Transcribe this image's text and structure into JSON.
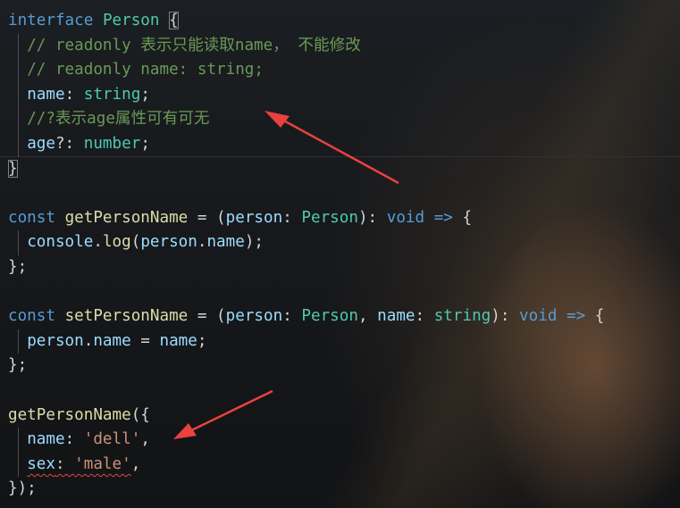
{
  "editor": {
    "line1": {
      "kw": "interface",
      "name": "Person",
      "brace": "{"
    },
    "line2": {
      "comment": "// readonly 表示只能读取name， 不能修改"
    },
    "line3": {
      "comment": "// readonly name: string;"
    },
    "line4": {
      "prop": "name",
      "colon": ": ",
      "type": "string",
      "semi": ";"
    },
    "line5": {
      "comment": "//?表示age属性可有可无"
    },
    "line6": {
      "prop": "age",
      "op": "?: ",
      "type": "number",
      "semi": ";"
    },
    "line7": {
      "brace": "}"
    },
    "line9": {
      "kw": "const",
      "fn": "getPersonName",
      "eq": " = (",
      "param": "person",
      "colon": ": ",
      "type": "Person",
      "close": "): ",
      "ret": "void",
      "arrow": " => ",
      "brace": "{"
    },
    "line10": {
      "obj": "console",
      "dot": ".",
      "fn": "log",
      "open": "(",
      "param": "person",
      "dot2": ".",
      "prop": "name",
      "close": ");"
    },
    "line11": {
      "text": "};"
    },
    "line13": {
      "kw": "const",
      "fn": "setPersonName",
      "eq": " = (",
      "param": "person",
      "colon": ": ",
      "type": "Person",
      "comma": ", ",
      "param2": "name",
      "colon2": ": ",
      "type2": "string",
      "close": "): ",
      "ret": "void",
      "arrow": " => ",
      "brace": "{"
    },
    "line14": {
      "obj": "person",
      "dot": ".",
      "prop": "name",
      "eq": " = ",
      "val": "name",
      "semi": ";"
    },
    "line15": {
      "text": "};"
    },
    "line17": {
      "fn": "getPersonName",
      "open": "({"
    },
    "line18": {
      "prop": "name",
      "colon": ": ",
      "str": "'dell'",
      "comma": ","
    },
    "line19": {
      "prop": "sex",
      "colon": ": ",
      "str": "'male'",
      "comma": ","
    },
    "line20": {
      "text": "});"
    }
  },
  "colors": {
    "keyword": "#569cd6",
    "type": "#4ec9b0",
    "function": "#dcdcaa",
    "property": "#9cdcfe",
    "string": "#ce9178",
    "comment": "#6a9955",
    "annotation_arrow": "#e8423f"
  }
}
